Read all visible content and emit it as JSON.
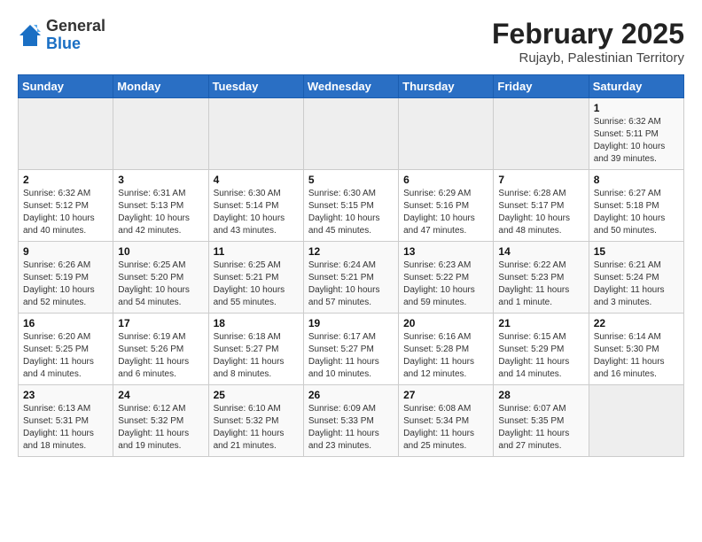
{
  "header": {
    "logo_general": "General",
    "logo_blue": "Blue",
    "month_year": "February 2025",
    "location": "Rujayb, Palestinian Territory"
  },
  "days_of_week": [
    "Sunday",
    "Monday",
    "Tuesday",
    "Wednesday",
    "Thursday",
    "Friday",
    "Saturday"
  ],
  "weeks": [
    [
      {
        "day": "",
        "info": ""
      },
      {
        "day": "",
        "info": ""
      },
      {
        "day": "",
        "info": ""
      },
      {
        "day": "",
        "info": ""
      },
      {
        "day": "",
        "info": ""
      },
      {
        "day": "",
        "info": ""
      },
      {
        "day": "1",
        "info": "Sunrise: 6:32 AM\nSunset: 5:11 PM\nDaylight: 10 hours and 39 minutes."
      }
    ],
    [
      {
        "day": "2",
        "info": "Sunrise: 6:32 AM\nSunset: 5:12 PM\nDaylight: 10 hours and 40 minutes."
      },
      {
        "day": "3",
        "info": "Sunrise: 6:31 AM\nSunset: 5:13 PM\nDaylight: 10 hours and 42 minutes."
      },
      {
        "day": "4",
        "info": "Sunrise: 6:30 AM\nSunset: 5:14 PM\nDaylight: 10 hours and 43 minutes."
      },
      {
        "day": "5",
        "info": "Sunrise: 6:30 AM\nSunset: 5:15 PM\nDaylight: 10 hours and 45 minutes."
      },
      {
        "day": "6",
        "info": "Sunrise: 6:29 AM\nSunset: 5:16 PM\nDaylight: 10 hours and 47 minutes."
      },
      {
        "day": "7",
        "info": "Sunrise: 6:28 AM\nSunset: 5:17 PM\nDaylight: 10 hours and 48 minutes."
      },
      {
        "day": "8",
        "info": "Sunrise: 6:27 AM\nSunset: 5:18 PM\nDaylight: 10 hours and 50 minutes."
      }
    ],
    [
      {
        "day": "9",
        "info": "Sunrise: 6:26 AM\nSunset: 5:19 PM\nDaylight: 10 hours and 52 minutes."
      },
      {
        "day": "10",
        "info": "Sunrise: 6:25 AM\nSunset: 5:20 PM\nDaylight: 10 hours and 54 minutes."
      },
      {
        "day": "11",
        "info": "Sunrise: 6:25 AM\nSunset: 5:21 PM\nDaylight: 10 hours and 55 minutes."
      },
      {
        "day": "12",
        "info": "Sunrise: 6:24 AM\nSunset: 5:21 PM\nDaylight: 10 hours and 57 minutes."
      },
      {
        "day": "13",
        "info": "Sunrise: 6:23 AM\nSunset: 5:22 PM\nDaylight: 10 hours and 59 minutes."
      },
      {
        "day": "14",
        "info": "Sunrise: 6:22 AM\nSunset: 5:23 PM\nDaylight: 11 hours and 1 minute."
      },
      {
        "day": "15",
        "info": "Sunrise: 6:21 AM\nSunset: 5:24 PM\nDaylight: 11 hours and 3 minutes."
      }
    ],
    [
      {
        "day": "16",
        "info": "Sunrise: 6:20 AM\nSunset: 5:25 PM\nDaylight: 11 hours and 4 minutes."
      },
      {
        "day": "17",
        "info": "Sunrise: 6:19 AM\nSunset: 5:26 PM\nDaylight: 11 hours and 6 minutes."
      },
      {
        "day": "18",
        "info": "Sunrise: 6:18 AM\nSunset: 5:27 PM\nDaylight: 11 hours and 8 minutes."
      },
      {
        "day": "19",
        "info": "Sunrise: 6:17 AM\nSunset: 5:27 PM\nDaylight: 11 hours and 10 minutes."
      },
      {
        "day": "20",
        "info": "Sunrise: 6:16 AM\nSunset: 5:28 PM\nDaylight: 11 hours and 12 minutes."
      },
      {
        "day": "21",
        "info": "Sunrise: 6:15 AM\nSunset: 5:29 PM\nDaylight: 11 hours and 14 minutes."
      },
      {
        "day": "22",
        "info": "Sunrise: 6:14 AM\nSunset: 5:30 PM\nDaylight: 11 hours and 16 minutes."
      }
    ],
    [
      {
        "day": "23",
        "info": "Sunrise: 6:13 AM\nSunset: 5:31 PM\nDaylight: 11 hours and 18 minutes."
      },
      {
        "day": "24",
        "info": "Sunrise: 6:12 AM\nSunset: 5:32 PM\nDaylight: 11 hours and 19 minutes."
      },
      {
        "day": "25",
        "info": "Sunrise: 6:10 AM\nSunset: 5:32 PM\nDaylight: 11 hours and 21 minutes."
      },
      {
        "day": "26",
        "info": "Sunrise: 6:09 AM\nSunset: 5:33 PM\nDaylight: 11 hours and 23 minutes."
      },
      {
        "day": "27",
        "info": "Sunrise: 6:08 AM\nSunset: 5:34 PM\nDaylight: 11 hours and 25 minutes."
      },
      {
        "day": "28",
        "info": "Sunrise: 6:07 AM\nSunset: 5:35 PM\nDaylight: 11 hours and 27 minutes."
      },
      {
        "day": "",
        "info": ""
      }
    ]
  ]
}
